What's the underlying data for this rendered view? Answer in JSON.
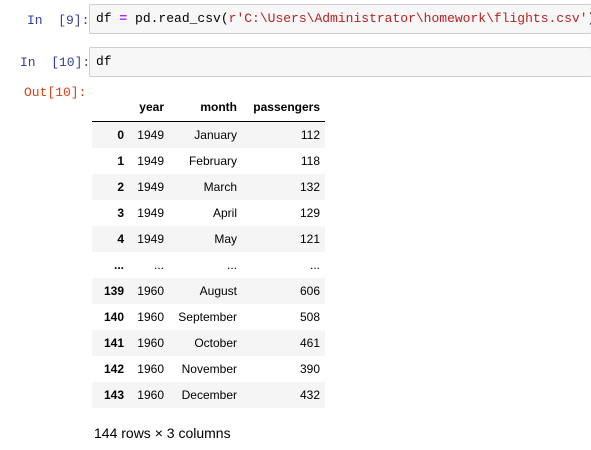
{
  "cell9": {
    "prompt": "In  [9]:",
    "code": {
      "pre": "df ",
      "eq": "=",
      "mid": " pd.read_csv(",
      "str": "r'C:\\Users\\Administrator\\homework\\flights.csv'",
      "post": ")"
    }
  },
  "cell10": {
    "prompt": "In  [10]:",
    "code": "df",
    "out_prompt": "Out[10]:"
  },
  "table": {
    "columns": [
      "",
      "year",
      "month",
      "passengers"
    ],
    "rows": [
      [
        "0",
        "1949",
        "January",
        "112"
      ],
      [
        "1",
        "1949",
        "February",
        "118"
      ],
      [
        "2",
        "1949",
        "March",
        "132"
      ],
      [
        "3",
        "1949",
        "April",
        "129"
      ],
      [
        "4",
        "1949",
        "May",
        "121"
      ],
      [
        "...",
        "...",
        "...",
        "..."
      ],
      [
        "139",
        "1960",
        "August",
        "606"
      ],
      [
        "140",
        "1960",
        "September",
        "508"
      ],
      [
        "141",
        "1960",
        "October",
        "461"
      ],
      [
        "142",
        "1960",
        "November",
        "390"
      ],
      [
        "143",
        "1960",
        "December",
        "432"
      ]
    ],
    "summary": "144 rows × 3 columns"
  }
}
